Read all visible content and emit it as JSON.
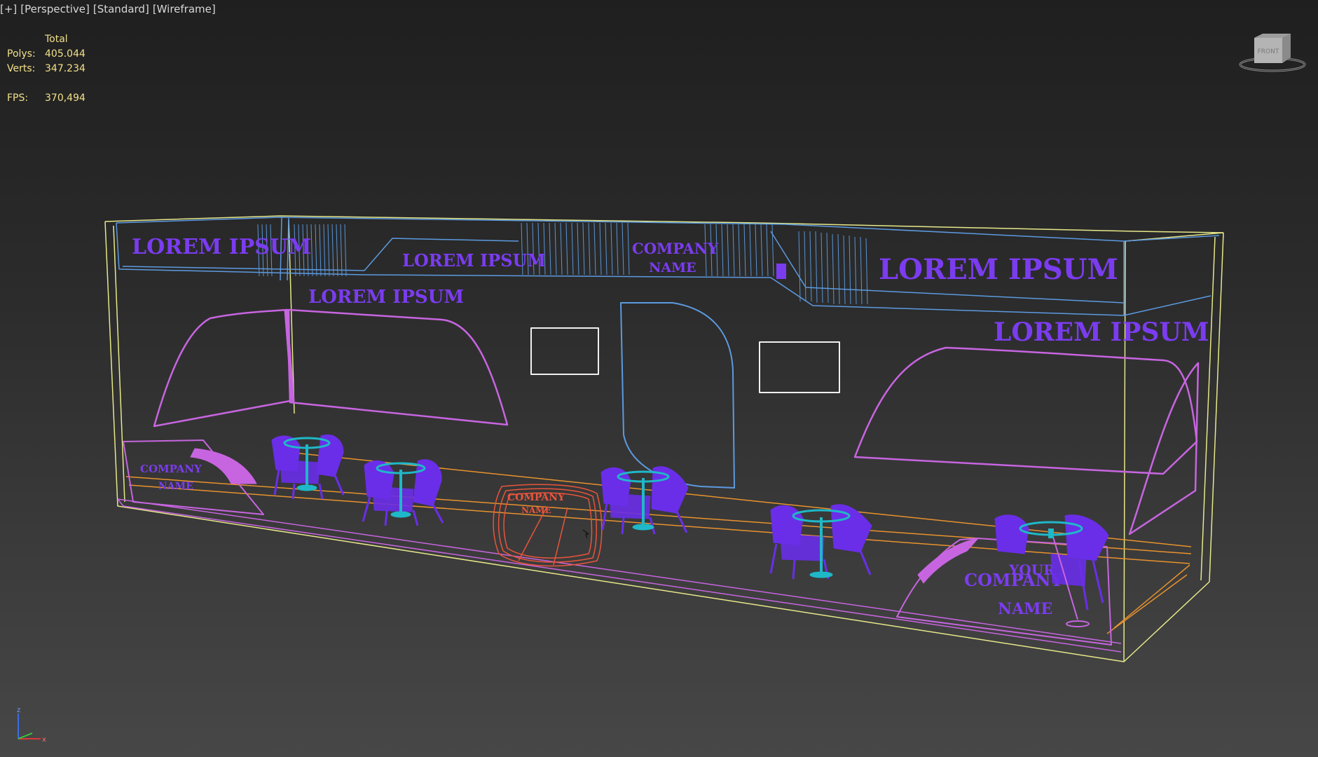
{
  "viewport": {
    "labels": [
      "[+]",
      "[Perspective]",
      "[Standard]",
      "[Wireframe]"
    ]
  },
  "stats": {
    "header": "Total",
    "polys_label": "Polys:",
    "polys_value": "405.044",
    "verts_label": "Verts:",
    "verts_value": "347.234",
    "fps_label": "FPS:",
    "fps_value": "370,494"
  },
  "viewcube": {
    "face_label": "FRONT"
  },
  "axis_tripod": {
    "z": "z",
    "x": "x",
    "y": "y"
  },
  "scene_text": {
    "lorem_top_left": "LOREM IPSUM",
    "lorem_top_mid": "LOREM IPSUM",
    "company_top_1": "COMPANY",
    "company_top_2": "NAME",
    "lorem_top_right": "LOREM IPSUM",
    "lorem_wall_left": "LOREM IPSUM",
    "lorem_wall_right": "LOREM IPSUM",
    "counter_left_1": "COMPANY",
    "counter_left_2": "NAME",
    "counter_mid_1": "COMPANY",
    "counter_mid_2": "NAME",
    "counter_right_1": "YOUR",
    "counter_right_2": "COMPANY",
    "counter_right_3": "NAME"
  },
  "colors": {
    "booth_outline": "#e6e88a",
    "ceiling": "#5c9ae0",
    "wall_frame": "#c765e0",
    "text_purple": "#7b3cf0",
    "furniture": "#6a2ee8",
    "table_top": "#1fb8c8",
    "counter_red": "#e8553c",
    "floor_orange": "#e8922e",
    "stats_yellow": "#f2e089"
  }
}
